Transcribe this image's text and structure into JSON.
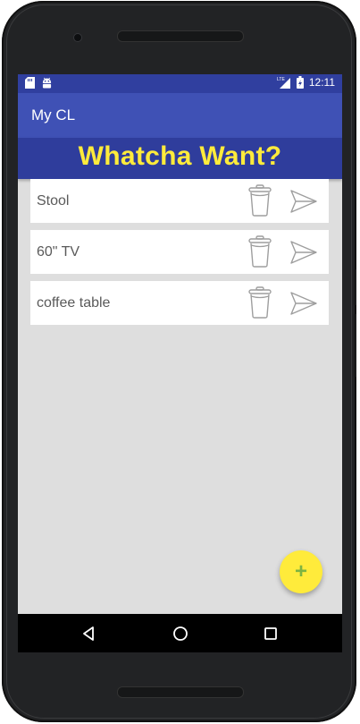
{
  "app": {
    "title": "My CL"
  },
  "status_bar": {
    "time": "12:11",
    "network": "LTE"
  },
  "banner": {
    "text": "Whatcha Want?"
  },
  "items": [
    {
      "label": "Stool"
    },
    {
      "label": "60\" TV"
    },
    {
      "label": "coffee table"
    }
  ],
  "fab": {
    "label": "+"
  },
  "colors": {
    "status_bar": "#303f9f",
    "app_bar": "#3f51b5",
    "banner_bg": "#2f3d9c",
    "banner_text": "#ffeb3b",
    "fab": "#ffeb3b",
    "fab_icon": "#7cb342",
    "list_bg": "#dedede"
  },
  "icons": {
    "trash": "trash-icon",
    "send": "send-icon",
    "back": "back-icon",
    "home": "home-icon",
    "recents": "recents-icon"
  }
}
